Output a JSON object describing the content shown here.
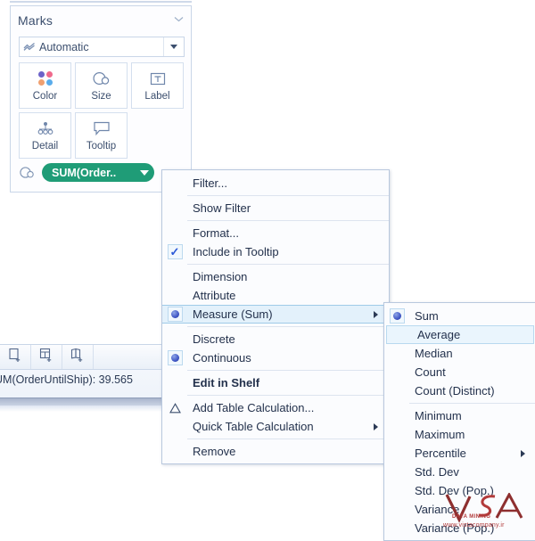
{
  "marks_card": {
    "title": "Marks",
    "collapse_icon": "chevron-down-icon",
    "mark_type": {
      "label": "Automatic",
      "icon": "automatic-mark-icon",
      "dropdown_icon": "caret-down-icon"
    },
    "buttons": [
      {
        "label": "Color",
        "icon": "color-dots-icon"
      },
      {
        "label": "Size",
        "icon": "size-circles-icon"
      },
      {
        "label": "Label",
        "icon": "label-T-icon"
      },
      {
        "label": "Detail",
        "icon": "detail-dots-icon"
      },
      {
        "label": "Tooltip",
        "icon": "tooltip-bubble-icon"
      }
    ],
    "pill": {
      "icon": "size-circles-icon",
      "text": "SUM(Order..",
      "dropdown_icon": "caret-down-icon",
      "color": "#1f9c77"
    }
  },
  "bottom_bar": {
    "tabs": [
      {
        "icon": "new-worksheet-icon"
      },
      {
        "icon": "new-dashboard-icon"
      },
      {
        "icon": "new-story-icon"
      }
    ],
    "status_text": "UM(OrderUntilShip): 39.565"
  },
  "context_menu": {
    "items": [
      {
        "label": "Filter...",
        "gutter": "none",
        "arrow": false,
        "bold": false,
        "highlight": false
      },
      {
        "sep": true
      },
      {
        "label": "Show Filter",
        "gutter": "none",
        "arrow": false,
        "bold": false,
        "highlight": false
      },
      {
        "sep": true
      },
      {
        "label": "Format...",
        "gutter": "none",
        "arrow": false,
        "bold": false,
        "highlight": false
      },
      {
        "label": "Include in Tooltip",
        "gutter": "check",
        "arrow": false,
        "bold": false,
        "highlight": false
      },
      {
        "sep": true
      },
      {
        "label": "Dimension",
        "gutter": "none",
        "arrow": false,
        "bold": false,
        "highlight": false
      },
      {
        "label": "Attribute",
        "gutter": "none",
        "arrow": false,
        "bold": false,
        "highlight": false
      },
      {
        "label": "Measure (Sum)",
        "gutter": "radio",
        "arrow": true,
        "bold": false,
        "highlight": true
      },
      {
        "sep": true
      },
      {
        "label": "Discrete",
        "gutter": "none",
        "arrow": false,
        "bold": false,
        "highlight": false
      },
      {
        "label": "Continuous",
        "gutter": "radio",
        "arrow": false,
        "bold": false,
        "highlight": false
      },
      {
        "sep": true
      },
      {
        "label": "Edit in Shelf",
        "gutter": "none",
        "arrow": false,
        "bold": true,
        "highlight": false
      },
      {
        "sep": true
      },
      {
        "label": "Add Table Calculation...",
        "gutter": "triangle",
        "arrow": false,
        "bold": false,
        "highlight": false
      },
      {
        "label": "Quick Table Calculation",
        "gutter": "none",
        "arrow": true,
        "bold": false,
        "highlight": false
      },
      {
        "sep": true
      },
      {
        "label": "Remove",
        "gutter": "none",
        "arrow": false,
        "bold": false,
        "highlight": false
      }
    ]
  },
  "submenu": {
    "items": [
      {
        "label": "Sum",
        "gutter": "radio",
        "arrow": false,
        "highlight": false
      },
      {
        "label": "Average",
        "gutter": "none",
        "arrow": false,
        "highlight": true
      },
      {
        "label": "Median",
        "gutter": "none",
        "arrow": false,
        "highlight": false
      },
      {
        "label": "Count",
        "gutter": "none",
        "arrow": false,
        "highlight": false
      },
      {
        "label": "Count (Distinct)",
        "gutter": "none",
        "arrow": false,
        "highlight": false
      },
      {
        "sep": true
      },
      {
        "label": "Minimum",
        "gutter": "none",
        "arrow": false,
        "highlight": false
      },
      {
        "label": "Maximum",
        "gutter": "none",
        "arrow": false,
        "highlight": false
      },
      {
        "label": "Percentile",
        "gutter": "none",
        "arrow": true,
        "highlight": false
      },
      {
        "label": "Std. Dev",
        "gutter": "none",
        "arrow": false,
        "highlight": false
      },
      {
        "label": "Std. Dev (Pop.)",
        "gutter": "none",
        "arrow": false,
        "highlight": false
      },
      {
        "label": "Variance",
        "gutter": "none",
        "arrow": false,
        "highlight": false
      },
      {
        "label": "Variance (Pop.)",
        "gutter": "none",
        "arrow": false,
        "highlight": false
      }
    ]
  },
  "watermark": {
    "logo": "vsa-logo",
    "tagline": "DATA MINING",
    "url": "www.vistacompany.ir",
    "color": "#b23b3b"
  },
  "theme": {
    "pill_green": "#1f9c77",
    "menu_bg": "#fbfcfe",
    "menu_border": "#b9c8de",
    "highlight_bg": "#e3f1fb",
    "text": "#23314c"
  }
}
